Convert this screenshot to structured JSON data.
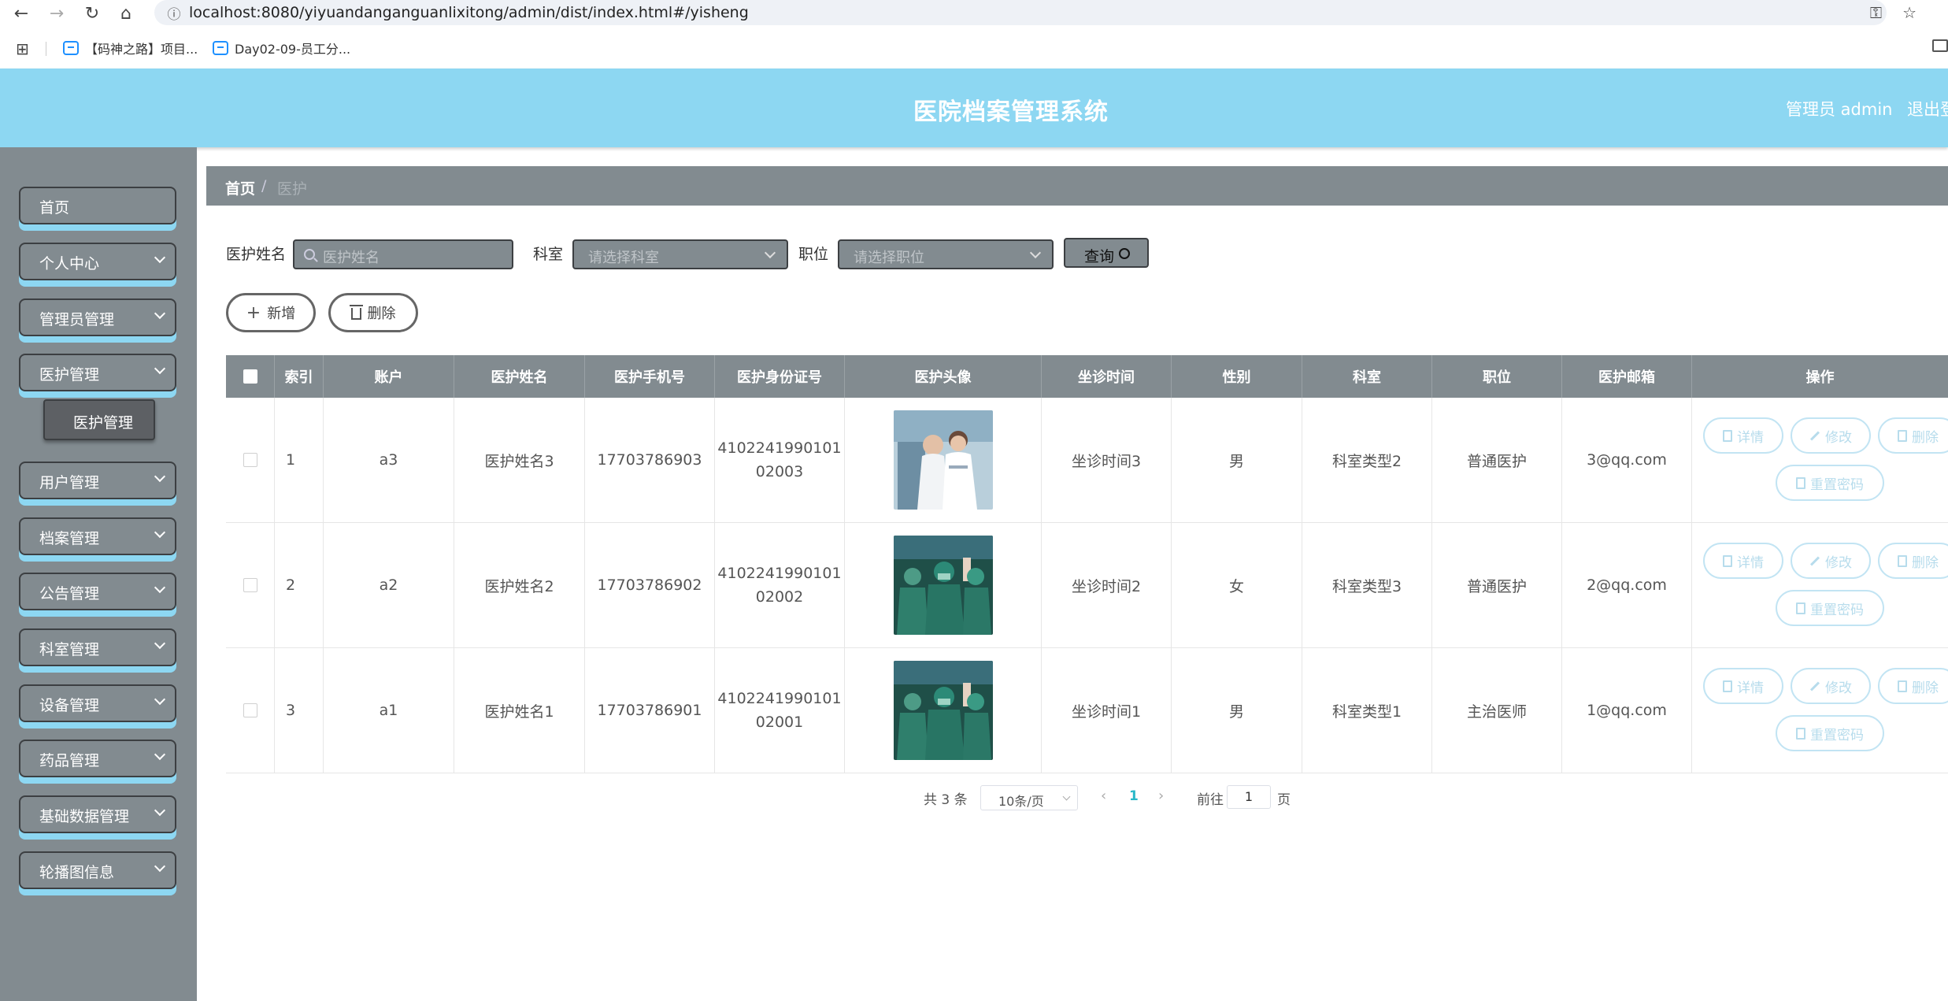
{
  "browser": {
    "url": "localhost:8080/yiyuandanganguanlixitong/admin/dist/index.html#/yisheng",
    "bookmarks": [
      "【码神之路】项目...",
      "Day02-09-员工分..."
    ]
  },
  "header": {
    "title": "医院档案管理系统",
    "user": "管理员 admin",
    "logout": "退出登"
  },
  "sidebar": {
    "items": [
      "首页",
      "个人中心",
      "管理员管理",
      "医护管理",
      "用户管理",
      "档案管理",
      "公告管理",
      "科室管理",
      "设备管理",
      "药品管理",
      "基础数据管理",
      "轮播图信息"
    ],
    "submenu": "医护管理"
  },
  "breadcrumb": {
    "home": "首页",
    "separator": "/",
    "current": "医护"
  },
  "search": {
    "name_label": "医护姓名",
    "name_placeholder": "医护姓名",
    "dept_label": "科室",
    "dept_placeholder": "请选择科室",
    "position_label": "职位",
    "position_placeholder": "请选择职位",
    "query_button": "查询"
  },
  "actions": {
    "add": "新增",
    "delete": "删除"
  },
  "table": {
    "headers": [
      "索引",
      "账户",
      "医护姓名",
      "医护手机号",
      "医护身份证号",
      "医护头像",
      "坐诊时间",
      "性别",
      "科室",
      "职位",
      "医护邮箱",
      "操作"
    ],
    "rows": [
      {
        "index": "1",
        "account": "a3",
        "name": "医护姓名3",
        "phone": "17703786903",
        "id_line1": "4102241990101",
        "id_line2": "02003",
        "time": "坐诊时间3",
        "gender": "男",
        "dept": "科室类型2",
        "position": "普通医护",
        "email": "3@qq.com"
      },
      {
        "index": "2",
        "account": "a2",
        "name": "医护姓名2",
        "phone": "17703786902",
        "id_line1": "4102241990101",
        "id_line2": "02002",
        "time": "坐诊时间2",
        "gender": "女",
        "dept": "科室类型3",
        "position": "普通医护",
        "email": "2@qq.com"
      },
      {
        "index": "3",
        "account": "a1",
        "name": "医护姓名1",
        "phone": "17703786901",
        "id_line1": "4102241990101",
        "id_line2": "02001",
        "time": "坐诊时间1",
        "gender": "男",
        "dept": "科室类型1",
        "position": "主治医师",
        "email": "1@qq.com"
      }
    ],
    "row_actions": {
      "detail": "详情",
      "edit": "修改",
      "delete": "删除",
      "reset_password": "重置密码"
    }
  },
  "pagination": {
    "total": "共 3 条",
    "page_size": "10条/页",
    "current_page": "1",
    "goto_prefix": "前往",
    "goto_value": "1",
    "goto_suffix": "页"
  },
  "colors": {
    "header_bg": "#8dd7f2",
    "sidebar_bg": "#828b90",
    "accent_shadow": "#8dd7f2",
    "table_header_bg": "#828b90",
    "op_button_text": "#b7dcec",
    "pager_active": "#28b8c8"
  }
}
